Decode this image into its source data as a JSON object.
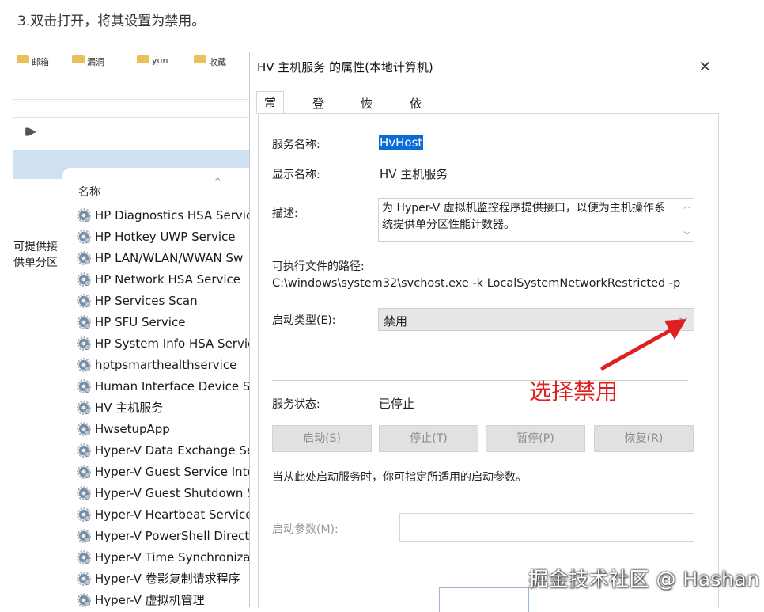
{
  "caption": "3.双击打开，将其设置为禁用。",
  "background_window": {
    "column_header": "名称",
    "left_description_lines": [
      "可提供接",
      "供单分区"
    ],
    "bookmarks": [
      "邮箱",
      "漏洞",
      "yun",
      "收藏"
    ],
    "services": [
      "HP Diagnostics HSA Service",
      "HP Hotkey UWP Service",
      "HP LAN/WLAN/WWAN Sw",
      "HP Network HSA Service",
      "HP Services Scan",
      "HP SFU Service",
      "HP System Info HSA Service",
      "hptpsmarthealthservice",
      "Human Interface Device Ser",
      "HV 主机服务",
      "HwsetupApp",
      "Hyper-V Data Exchange Ser",
      "Hyper-V Guest Service Inter",
      "Hyper-V Guest Shutdown Se",
      "Hyper-V Heartbeat Service",
      "Hyper-V PowerShell Direct S",
      "Hyper-V Time Synchronizat",
      "Hyper-V 卷影复制请求程序",
      "Hyper-V 虚拟机管理"
    ]
  },
  "dialog": {
    "title": "HV 主机服务 的属性(本地计算机)",
    "close": "×",
    "tabs": [
      {
        "label": "常规",
        "active": true
      },
      {
        "label": "登录",
        "active": false
      },
      {
        "label": "恢复",
        "active": false
      },
      {
        "label": "依存关系",
        "active": false
      }
    ],
    "service_name_label": "服务名称:",
    "service_name": "HvHost",
    "display_name_label": "显示名称:",
    "display_name": "HV 主机服务",
    "description_label": "描述:",
    "description": "为 Hyper-V 虚拟机监控程序提供接口，以便为主机操作系统提供单分区性能计数器。",
    "exe_path_label": "可执行文件的路径:",
    "exe_path": "C:\\windows\\system32\\svchost.exe -k LocalSystemNetworkRestricted -p",
    "startup_type_label": "启动类型(E):",
    "startup_type": "禁用",
    "status_label": "服务状态:",
    "status": "已停止",
    "buttons": {
      "start": "启动(S)",
      "stop": "停止(T)",
      "pause": "暂停(P)",
      "resume": "恢复(R)"
    },
    "hint": "当从此处启动服务时，你可指定所适用的启动参数。",
    "params_label": "启动参数(M):",
    "params_value": ""
  },
  "annotation": {
    "text": "选择禁用",
    "color": "#e02020"
  },
  "watermark": "掘金技术社区 @ Hashan",
  "colors": {
    "selection": "#0a6cd7",
    "accent_blue": "#cfe0f3"
  }
}
